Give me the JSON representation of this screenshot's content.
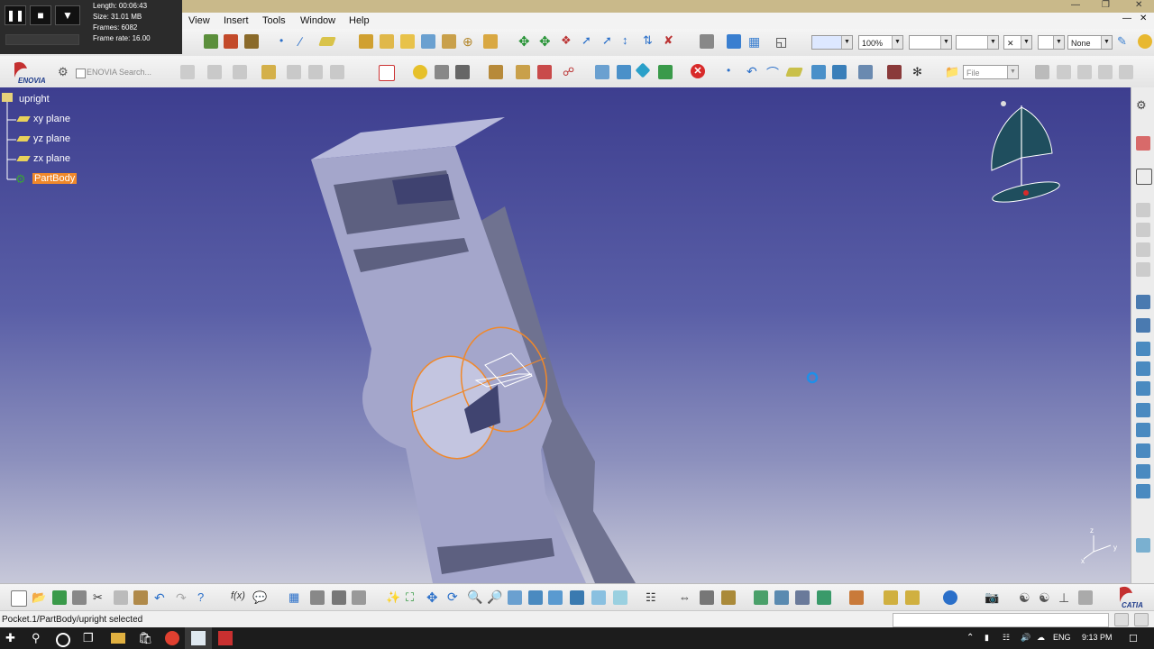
{
  "recorder": {
    "length": "Length: 00:06:43",
    "size": "Size: 31.01 MB",
    "frames": "Frames: 6082",
    "frame_rate": "Frame rate: 16.00"
  },
  "menu": [
    "View",
    "Insert",
    "Tools",
    "Window",
    "Help"
  ],
  "toolbar1": {
    "zoom_value": "100%",
    "layer_value": "None"
  },
  "toolbar2": {
    "enovia_label": "ENOVIA",
    "enovia_search": "ENOVIA Search...",
    "file_combo": "File"
  },
  "tree": {
    "root": "upright",
    "items": [
      "xy plane",
      "yz plane",
      "zx plane"
    ],
    "body": "PartBody"
  },
  "compass_axes": {
    "x": "x",
    "y": "y",
    "z": "z"
  },
  "status": {
    "message": "Pocket.1/PartBody/upright selected"
  },
  "taskbar": {
    "language": "ENG",
    "time": "9:13 PM"
  },
  "brand": "CATIA",
  "colors": {
    "selection_orange": "#f0882a",
    "viewport_top": "#3d3e8f",
    "viewport_bottom": "#c7c8d9"
  }
}
